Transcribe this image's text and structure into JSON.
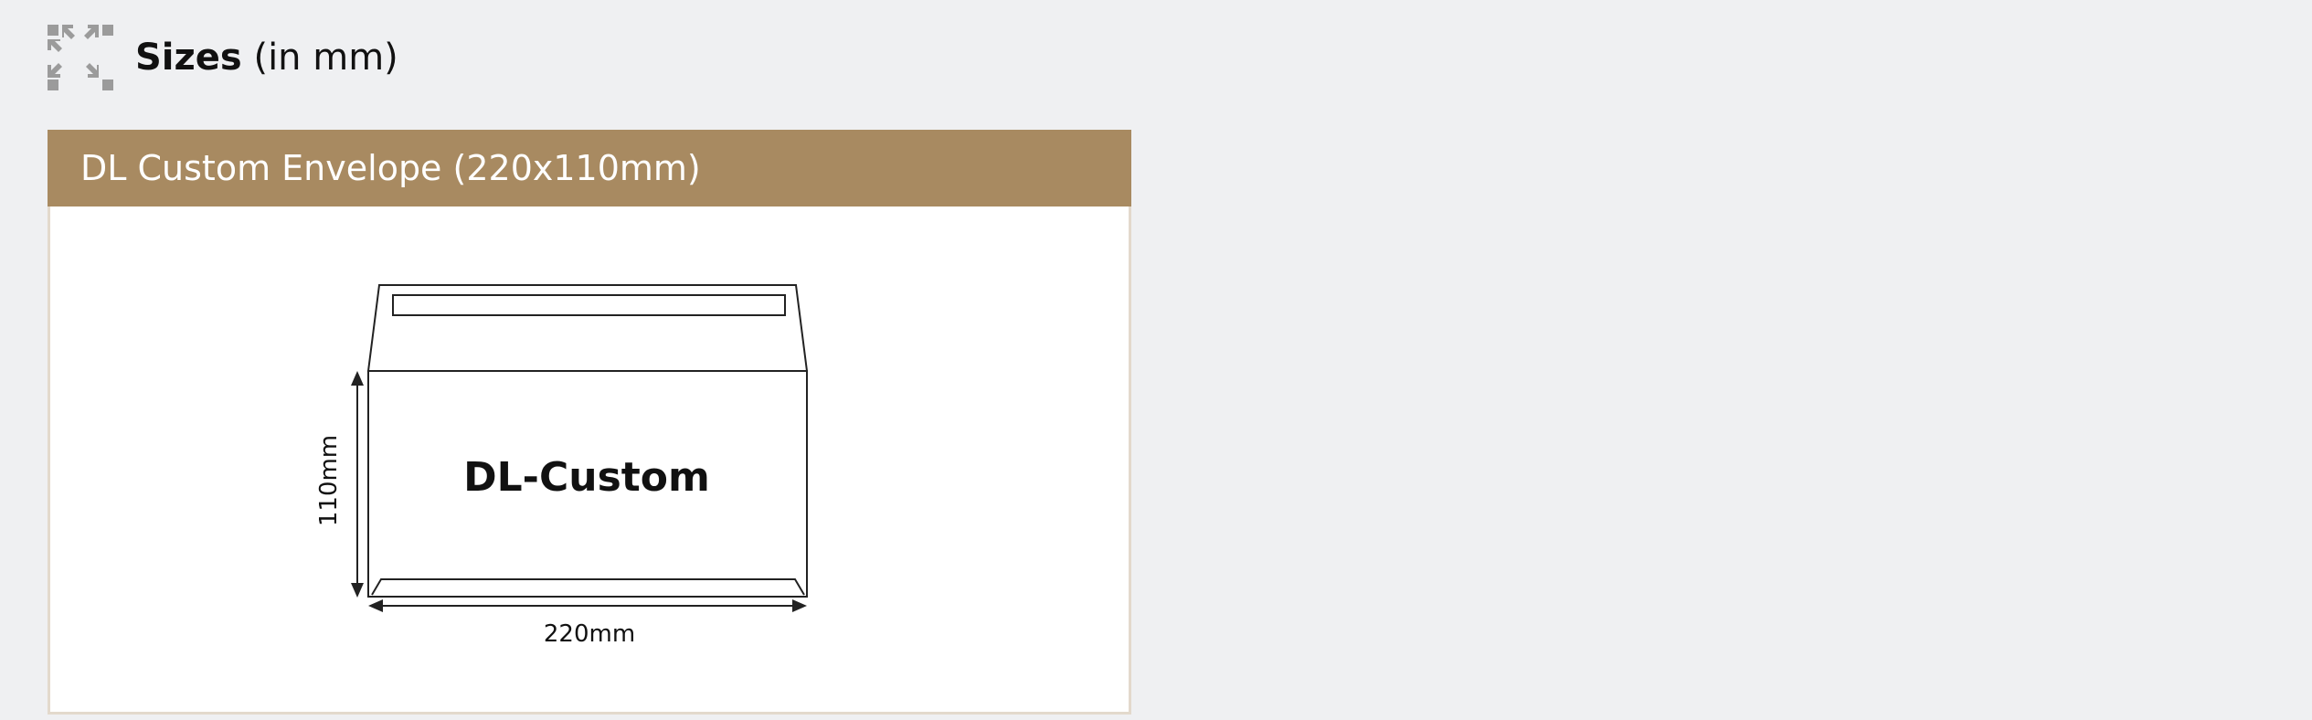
{
  "header": {
    "icon": "expand-arrows-icon",
    "title_bold": "Sizes",
    "title_rest": " (in mm)"
  },
  "card": {
    "title": "DL Custom Envelope (220x110mm)",
    "header_color": "#a88a61",
    "border_color": "#e3d9cc"
  },
  "diagram": {
    "envelope_label": "DL-Custom",
    "width_label": "220mm",
    "height_label": "110mm"
  }
}
